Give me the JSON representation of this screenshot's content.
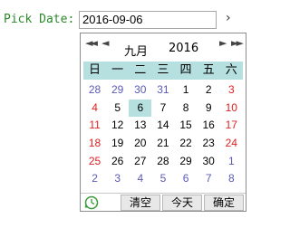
{
  "form": {
    "label": "Pick Date:",
    "value": "2016-09-06",
    "next_arrow": "›"
  },
  "calendar": {
    "month": "九月",
    "year": "2016",
    "nav": {
      "prev_year": "◄◄",
      "prev_month": "◄",
      "next_month": "►",
      "next_year": "►►"
    },
    "weekdays": [
      "日",
      "一",
      "二",
      "三",
      "四",
      "五",
      "六"
    ],
    "rows": [
      [
        "28",
        "29",
        "30",
        "31",
        "1",
        "2",
        "3"
      ],
      [
        "4",
        "5",
        "6",
        "7",
        "8",
        "9",
        "10"
      ],
      [
        "11",
        "12",
        "13",
        "14",
        "15",
        "16",
        "17"
      ],
      [
        "18",
        "19",
        "20",
        "21",
        "22",
        "23",
        "24"
      ],
      [
        "25",
        "26",
        "27",
        "28",
        "29",
        "30",
        "1"
      ],
      [
        "2",
        "3",
        "4",
        "5",
        "6",
        "7",
        "8"
      ]
    ],
    "selected": "6",
    "footer": {
      "clear": "清空",
      "today": "今天",
      "ok": "确定"
    },
    "colors": {
      "highlight": "#b6e0e0",
      "weekend": "#e02020",
      "other_month": "#5a5ab8",
      "label": "#2a8a2a"
    }
  }
}
